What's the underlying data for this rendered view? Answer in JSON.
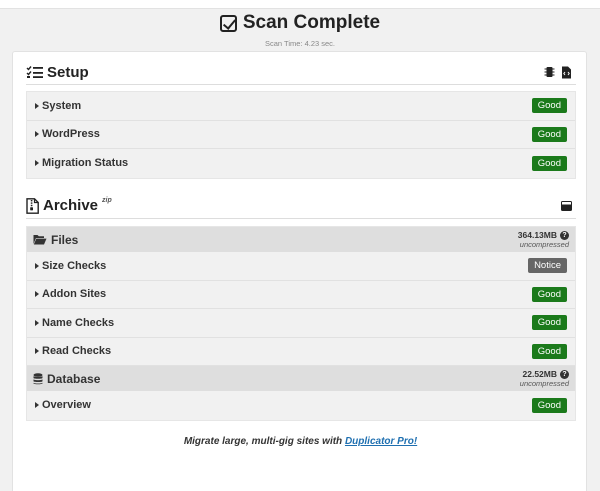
{
  "header": {
    "title": "Scan Complete",
    "scan_time": "Scan Time: 4.23 sec."
  },
  "setup": {
    "title": "Setup",
    "rows": [
      {
        "label": "System",
        "status": "Good"
      },
      {
        "label": "WordPress",
        "status": "Good"
      },
      {
        "label": "Migration Status",
        "status": "Good"
      }
    ]
  },
  "archive": {
    "title": "Archive",
    "format": "zip",
    "files": {
      "label": "Files",
      "size": "364.13MB",
      "size_note": "uncompressed",
      "rows": [
        {
          "label": "Size Checks",
          "status": "Notice"
        },
        {
          "label": "Addon Sites",
          "status": "Good"
        },
        {
          "label": "Name Checks",
          "status": "Good"
        },
        {
          "label": "Read Checks",
          "status": "Good"
        }
      ]
    },
    "database": {
      "label": "Database",
      "size": "22.52MB",
      "size_note": "uncompressed",
      "rows": [
        {
          "label": "Overview",
          "status": "Good"
        }
      ]
    }
  },
  "promo": {
    "text": "Migrate large, multi-gig sites with",
    "link_label": "Duplicator Pro!"
  },
  "icons": {
    "help": "?"
  },
  "colors": {
    "good": "#1b7a1b",
    "notice": "#666666",
    "link": "#1e6fb0"
  }
}
